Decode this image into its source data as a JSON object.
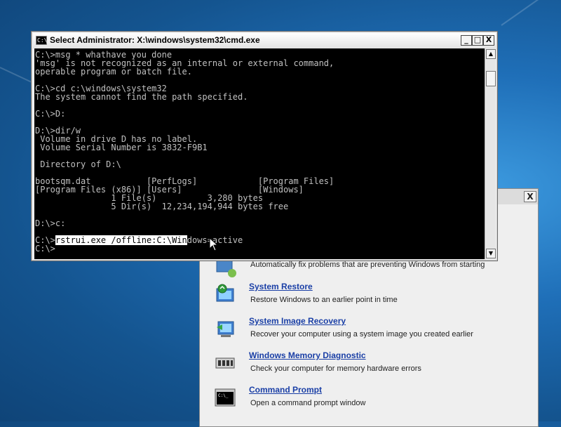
{
  "cmd_window": {
    "title": "Select Administrator: X:\\windows\\system32\\cmd.exe",
    "minimize_label": "_",
    "maximize_label": "□",
    "close_label": "X",
    "lines_before": [
      "C:\\>msg * whathave you done",
      "'msg' is not recognized as an internal or external command,",
      "operable program or batch file.",
      "",
      "C:\\>cd c:\\windows\\system32",
      "The system cannot find the path specified.",
      "",
      "C:\\>D:",
      "",
      "D:\\>dir/w",
      " Volume in drive D has no label.",
      " Volume Serial Number is 3832-F9B1",
      "",
      " Directory of D:\\",
      "",
      "bootsqm.dat           [PerfLogs]            [Program Files]",
      "[Program Files (x86)] [Users]               [Windows]",
      "               1 File(s)          3,280 bytes",
      "               5 Dir(s)  12,234,194,944 bytes free",
      "",
      "D:\\>c:",
      ""
    ],
    "prompt_text": "C:\\>",
    "selected_text": "rstrui.exe /offline:C:\\Win",
    "unselected_text": "dows=active",
    "lines_after": [
      "",
      "C:\\>"
    ]
  },
  "recovery": {
    "close_label": "X",
    "tools": [
      {
        "link": "",
        "desc": "Automatically fix problems that are preventing Windows from starting",
        "icon": "startup-repair-icon"
      },
      {
        "link": "System Restore",
        "desc": "Restore Windows to an earlier point in time",
        "icon": "system-restore-icon"
      },
      {
        "link": "System Image Recovery",
        "desc": "Recover your computer using a system image you created earlier",
        "icon": "system-image-recovery-icon"
      },
      {
        "link": "Windows Memory Diagnostic",
        "desc": "Check your computer for memory hardware errors",
        "icon": "memory-chip-icon"
      },
      {
        "link": "Command Prompt",
        "desc": "Open a command prompt window",
        "icon": "command-prompt-icon"
      }
    ]
  },
  "colors": {
    "console_bg": "#000000",
    "console_text": "#c0c0c0",
    "link": "#1a3fa6",
    "desktop": "#1f6fb8"
  }
}
